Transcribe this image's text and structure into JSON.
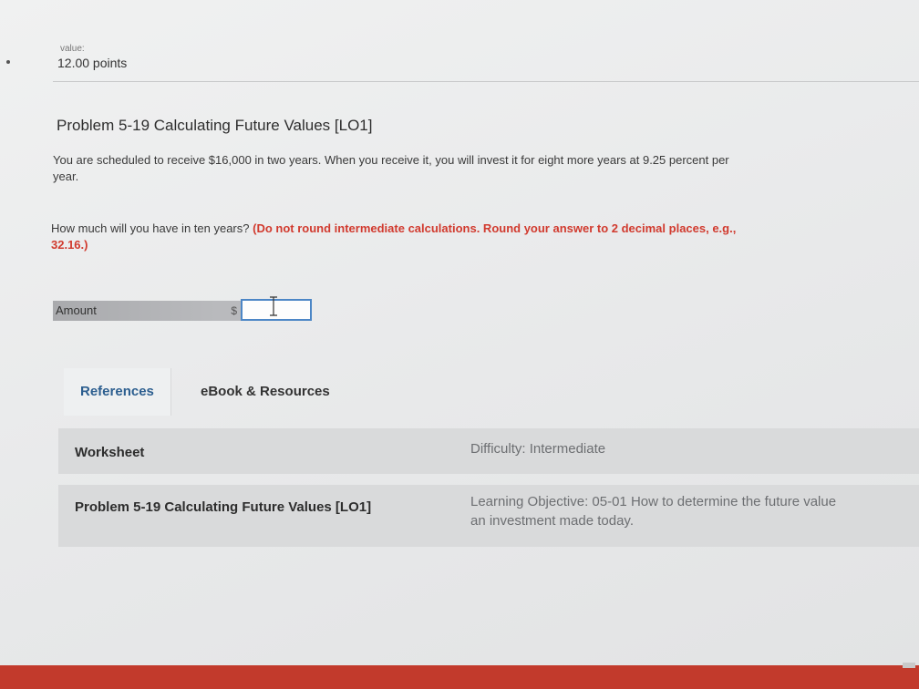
{
  "header": {
    "value_label": "value:",
    "points": "12.00 points"
  },
  "problem": {
    "title": "Problem 5-19 Calculating Future Values [LO1]",
    "text": "You are scheduled to receive $16,000 in two years. When you receive it, you will invest it for eight more years at 9.25 percent per year.",
    "question": "How much will you have in ten years?",
    "instruction": "(Do not round intermediate calculations. Round your answer to 2 decimal places, e.g., 32.16.)"
  },
  "answer": {
    "label": "Amount",
    "currency": "$",
    "value": ""
  },
  "references": {
    "tabs": [
      "References",
      "eBook & Resources"
    ],
    "rows": [
      {
        "left": "Worksheet",
        "right": "Difficulty: Intermediate"
      },
      {
        "left": "Problem 5-19 Calculating Future Values [LO1]",
        "right_line1": "Learning Objective: 05-01 How to determine the future value",
        "right_line2": "an investment made today."
      }
    ]
  },
  "colors": {
    "instruction_red": "#d13a2e",
    "tab_blue": "#2c5e8f",
    "footer_red": "#c23a2c",
    "input_border": "#4c86c6"
  },
  "icons": {
    "cursor": "text-cursor-icon"
  }
}
